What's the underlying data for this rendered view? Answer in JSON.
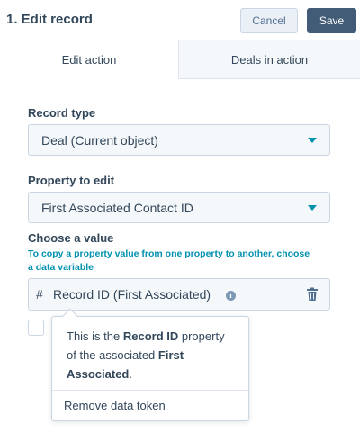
{
  "header": {
    "title": "1. Edit record",
    "cancel_label": "Cancel",
    "save_label": "Save",
    "colors": {
      "save_bg": "#425b76",
      "cancel_bg": "#eaf0f6",
      "accent": "#0091ae"
    }
  },
  "tabs": [
    {
      "label": "Edit action",
      "active": true
    },
    {
      "label": "Deals in action",
      "active": false
    }
  ],
  "form": {
    "record_type": {
      "label": "Record type",
      "value": "Deal (Current object)"
    },
    "property": {
      "label": "Property to edit",
      "value": "First Associated Contact ID"
    },
    "value": {
      "label": "Choose a value",
      "help": "To copy a property value from one property to another, choose a data variable",
      "token_symbol": "#",
      "token": "Record ID (First Associated)"
    }
  },
  "popover": {
    "t1": "This is the ",
    "b1": "Record ID",
    "t2": " property of the associated ",
    "b2": "First Associated",
    "t3": ".",
    "action": "Remove data token"
  },
  "icons": {
    "caret": "chevron-down-icon",
    "info": "info-icon",
    "delete": "trash-icon"
  }
}
